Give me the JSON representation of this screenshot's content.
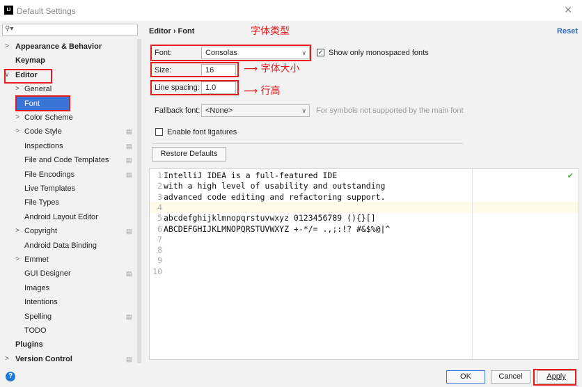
{
  "window": {
    "title": "Default Settings",
    "app_icon": "IJ",
    "close_icon": "close-icon"
  },
  "sidebar": {
    "search_placeholder": "",
    "items": [
      {
        "label": "Appearance & Behavior",
        "arrow": ">",
        "bold": true
      },
      {
        "label": "Keymap",
        "arrow": "",
        "bold": true
      },
      {
        "label": "Editor",
        "arrow": "∨",
        "bold": true
      },
      {
        "label": "General",
        "arrow": ">"
      },
      {
        "label": "Font",
        "arrow": "",
        "selected": true
      },
      {
        "label": "Color Scheme",
        "arrow": ">"
      },
      {
        "label": "Code Style",
        "arrow": ">",
        "project": true
      },
      {
        "label": "Inspections",
        "arrow": "",
        "project": true
      },
      {
        "label": "File and Code Templates",
        "arrow": "",
        "project": true
      },
      {
        "label": "File Encodings",
        "arrow": "",
        "project": true
      },
      {
        "label": "Live Templates",
        "arrow": ""
      },
      {
        "label": "File Types",
        "arrow": ""
      },
      {
        "label": "Android Layout Editor",
        "arrow": ""
      },
      {
        "label": "Copyright",
        "arrow": ">",
        "project": true
      },
      {
        "label": "Android Data Binding",
        "arrow": ""
      },
      {
        "label": "Emmet",
        "arrow": ">"
      },
      {
        "label": "GUI Designer",
        "arrow": "",
        "project": true
      },
      {
        "label": "Images",
        "arrow": ""
      },
      {
        "label": "Intentions",
        "arrow": ""
      },
      {
        "label": "Spelling",
        "arrow": "",
        "project": true
      },
      {
        "label": "TODO",
        "arrow": ""
      },
      {
        "label": "Plugins",
        "arrow": "",
        "bold": true
      },
      {
        "label": "Version Control",
        "arrow": ">",
        "bold": true,
        "project": true
      }
    ]
  },
  "content": {
    "breadcrumb": "Editor › Font",
    "reset": "Reset",
    "font_label": "Font:",
    "font_value": "Consolas",
    "monospaced_label": "Show only monospaced fonts",
    "monospaced_checked": true,
    "size_label": "Size:",
    "size_value": "16",
    "line_spacing_label": "Line spacing:",
    "line_spacing_value": "1.0",
    "fallback_label": "Fallback font:",
    "fallback_value": "<None>",
    "fallback_hint": "For symbols not supported by the main font",
    "ligatures_label": "Enable font ligatures",
    "ligatures_checked": false,
    "restore_defaults": "Restore Defaults"
  },
  "preview": {
    "lines": [
      {
        "num": "1",
        "text": "IntelliJ IDEA is a full-featured IDE"
      },
      {
        "num": "2",
        "text": "with a high level of usability and outstanding"
      },
      {
        "num": "3",
        "text": "advanced code editing and refactoring support."
      },
      {
        "num": "4",
        "text": ""
      },
      {
        "num": "5",
        "text": "abcdefghijklmnopqrstuvwxyz 0123456789 (){}[]"
      },
      {
        "num": "6",
        "text": "ABCDEFGHIJKLMNOPQRSTUVWXYZ +-*/= .,;:!? #&$%@|^"
      },
      {
        "num": "7",
        "text": ""
      },
      {
        "num": "8",
        "text": ""
      },
      {
        "num": "9",
        "text": ""
      },
      {
        "num": "10",
        "text": ""
      }
    ],
    "caret_line": 4
  },
  "footer": {
    "ok": "OK",
    "cancel": "Cancel",
    "apply": "Apply",
    "help": "?"
  },
  "annotations": {
    "font_type": "字体类型",
    "font_size": "字体大小",
    "line_height": "行高"
  },
  "colors": {
    "accent": "#3875d7",
    "annotation": "#e41b1b",
    "link": "#2a6cc0"
  }
}
